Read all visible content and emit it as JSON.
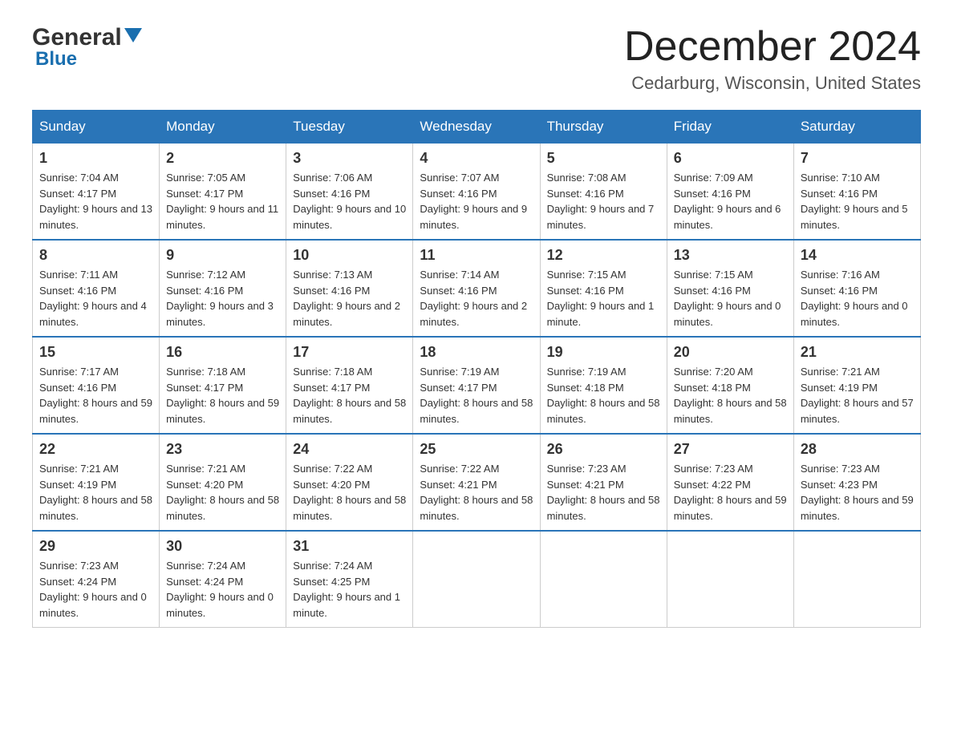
{
  "header": {
    "logo_general": "General",
    "logo_blue": "Blue",
    "title": "December 2024",
    "location": "Cedarburg, Wisconsin, United States"
  },
  "columns": [
    "Sunday",
    "Monday",
    "Tuesday",
    "Wednesday",
    "Thursday",
    "Friday",
    "Saturday"
  ],
  "weeks": [
    [
      {
        "day": "1",
        "sunrise": "7:04 AM",
        "sunset": "4:17 PM",
        "daylight": "9 hours and 13 minutes."
      },
      {
        "day": "2",
        "sunrise": "7:05 AM",
        "sunset": "4:17 PM",
        "daylight": "9 hours and 11 minutes."
      },
      {
        "day": "3",
        "sunrise": "7:06 AM",
        "sunset": "4:16 PM",
        "daylight": "9 hours and 10 minutes."
      },
      {
        "day": "4",
        "sunrise": "7:07 AM",
        "sunset": "4:16 PM",
        "daylight": "9 hours and 9 minutes."
      },
      {
        "day": "5",
        "sunrise": "7:08 AM",
        "sunset": "4:16 PM",
        "daylight": "9 hours and 7 minutes."
      },
      {
        "day": "6",
        "sunrise": "7:09 AM",
        "sunset": "4:16 PM",
        "daylight": "9 hours and 6 minutes."
      },
      {
        "day": "7",
        "sunrise": "7:10 AM",
        "sunset": "4:16 PM",
        "daylight": "9 hours and 5 minutes."
      }
    ],
    [
      {
        "day": "8",
        "sunrise": "7:11 AM",
        "sunset": "4:16 PM",
        "daylight": "9 hours and 4 minutes."
      },
      {
        "day": "9",
        "sunrise": "7:12 AM",
        "sunset": "4:16 PM",
        "daylight": "9 hours and 3 minutes."
      },
      {
        "day": "10",
        "sunrise": "7:13 AM",
        "sunset": "4:16 PM",
        "daylight": "9 hours and 2 minutes."
      },
      {
        "day": "11",
        "sunrise": "7:14 AM",
        "sunset": "4:16 PM",
        "daylight": "9 hours and 2 minutes."
      },
      {
        "day": "12",
        "sunrise": "7:15 AM",
        "sunset": "4:16 PM",
        "daylight": "9 hours and 1 minute."
      },
      {
        "day": "13",
        "sunrise": "7:15 AM",
        "sunset": "4:16 PM",
        "daylight": "9 hours and 0 minutes."
      },
      {
        "day": "14",
        "sunrise": "7:16 AM",
        "sunset": "4:16 PM",
        "daylight": "9 hours and 0 minutes."
      }
    ],
    [
      {
        "day": "15",
        "sunrise": "7:17 AM",
        "sunset": "4:16 PM",
        "daylight": "8 hours and 59 minutes."
      },
      {
        "day": "16",
        "sunrise": "7:18 AM",
        "sunset": "4:17 PM",
        "daylight": "8 hours and 59 minutes."
      },
      {
        "day": "17",
        "sunrise": "7:18 AM",
        "sunset": "4:17 PM",
        "daylight": "8 hours and 58 minutes."
      },
      {
        "day": "18",
        "sunrise": "7:19 AM",
        "sunset": "4:17 PM",
        "daylight": "8 hours and 58 minutes."
      },
      {
        "day": "19",
        "sunrise": "7:19 AM",
        "sunset": "4:18 PM",
        "daylight": "8 hours and 58 minutes."
      },
      {
        "day": "20",
        "sunrise": "7:20 AM",
        "sunset": "4:18 PM",
        "daylight": "8 hours and 58 minutes."
      },
      {
        "day": "21",
        "sunrise": "7:21 AM",
        "sunset": "4:19 PM",
        "daylight": "8 hours and 57 minutes."
      }
    ],
    [
      {
        "day": "22",
        "sunrise": "7:21 AM",
        "sunset": "4:19 PM",
        "daylight": "8 hours and 58 minutes."
      },
      {
        "day": "23",
        "sunrise": "7:21 AM",
        "sunset": "4:20 PM",
        "daylight": "8 hours and 58 minutes."
      },
      {
        "day": "24",
        "sunrise": "7:22 AM",
        "sunset": "4:20 PM",
        "daylight": "8 hours and 58 minutes."
      },
      {
        "day": "25",
        "sunrise": "7:22 AM",
        "sunset": "4:21 PM",
        "daylight": "8 hours and 58 minutes."
      },
      {
        "day": "26",
        "sunrise": "7:23 AM",
        "sunset": "4:21 PM",
        "daylight": "8 hours and 58 minutes."
      },
      {
        "day": "27",
        "sunrise": "7:23 AM",
        "sunset": "4:22 PM",
        "daylight": "8 hours and 59 minutes."
      },
      {
        "day": "28",
        "sunrise": "7:23 AM",
        "sunset": "4:23 PM",
        "daylight": "8 hours and 59 minutes."
      }
    ],
    [
      {
        "day": "29",
        "sunrise": "7:23 AM",
        "sunset": "4:24 PM",
        "daylight": "9 hours and 0 minutes."
      },
      {
        "day": "30",
        "sunrise": "7:24 AM",
        "sunset": "4:24 PM",
        "daylight": "9 hours and 0 minutes."
      },
      {
        "day": "31",
        "sunrise": "7:24 AM",
        "sunset": "4:25 PM",
        "daylight": "9 hours and 1 minute."
      },
      null,
      null,
      null,
      null
    ]
  ]
}
